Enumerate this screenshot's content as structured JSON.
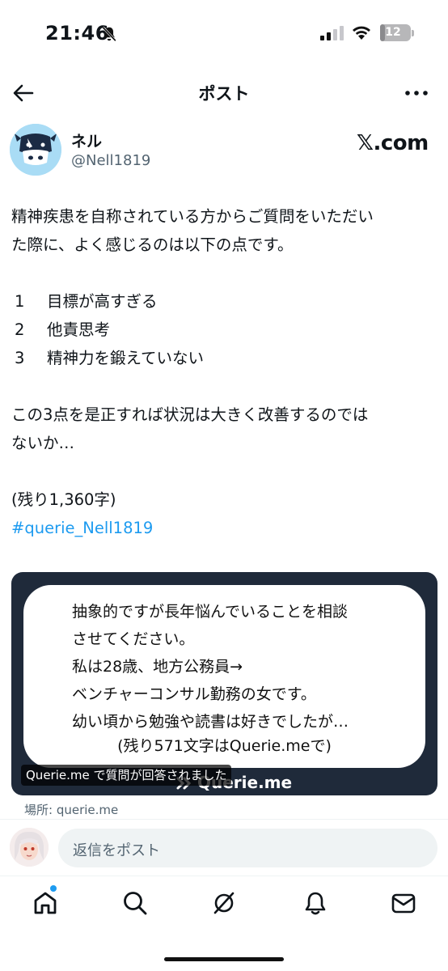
{
  "status_bar": {
    "time": "21:46",
    "battery_level": "12",
    "battery_fraction": 0.12,
    "icons": [
      "bell-slash-icon",
      "cellular-signal-icon",
      "wifi-icon",
      "battery-icon"
    ]
  },
  "header": {
    "title": "ポスト",
    "back_icon": "arrow-left-icon",
    "more_icon": "more-horizontal-icon"
  },
  "author": {
    "name": "ネル",
    "handle": "@Nell1819",
    "avatar_icon": "cow-avatar"
  },
  "brand": "𝕏.com",
  "post": {
    "line1": "精神疾患を自称されている方からご質問をいただい",
    "line2": "た際に、よく感じるのは以下の点です。",
    "list": [
      {
        "num": "1",
        "text": "目標が高すぎる"
      },
      {
        "num": "2",
        "text": "他責思考"
      },
      {
        "num": "3",
        "text": "精神力を鍛えていない"
      }
    ],
    "line6": "この3点を是正すれば状況は大きく改善するのでは",
    "line7": "ないか…",
    "remaining": "(残り1,360字)",
    "hashtag": "#querie_Nell1819"
  },
  "card": {
    "lines": [
      "抽象的ですが長年悩んでいることを相談",
      "させてください。",
      "私は28歳、地方公務員→",
      "ベンチャーコンサル勤務の女です。",
      "幼い頃から勉強や読書は好きでしたが…"
    ],
    "rest": "(残り571文字はQuerie.meで)",
    "brand": "Querie.me",
    "caption": "Querie.me で質問が回答されました",
    "colors": {
      "frame": "#1f2a3a",
      "inner": "#ffffff"
    }
  },
  "place": "場所: querie.me",
  "reply": {
    "placeholder": "返信をポスト"
  },
  "tabs": [
    "home-icon",
    "search-icon",
    "grok-icon",
    "notifications-icon",
    "messages-icon"
  ],
  "colors": {
    "accent": "#1d9bf0",
    "text": "#0f1419",
    "secondary": "#536471"
  }
}
